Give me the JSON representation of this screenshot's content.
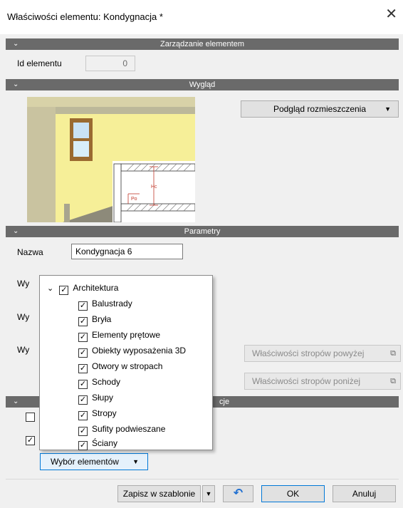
{
  "window": {
    "title": "Właściwości elementu: Kondygnacja *",
    "close_glyph": "✕"
  },
  "sections": {
    "management": "Zarządzanie elementem",
    "appearance": "Wygląd",
    "parameters": "Parametry",
    "fourth": "cje"
  },
  "management": {
    "id_label": "Id elementu",
    "id_value": "0"
  },
  "appearance": {
    "preview_dropdown": "Podgląd rozmieszczenia",
    "hc_label": "Hc",
    "po_label": "Po"
  },
  "parameters": {
    "name_label": "Nazwa",
    "name_value": "Kondygnacja 6",
    "partial_label_1": "Wy",
    "partial_label_2": "Wy",
    "partial_label_3": "Wy",
    "floors_above_button": "Właściwości stropów powyżej",
    "floors_below_button": "Właściwości stropów poniżej"
  },
  "popup": {
    "root": "Architektura",
    "items": [
      "Balustrady",
      "Bryła",
      "Elementy prętowe",
      "Obiekty wyposażenia 3D",
      "Otwory w stropach",
      "Schody",
      "Słupy",
      "Stropy",
      "Sufity podwieszane",
      "Ściany"
    ],
    "check_glyph": "✓",
    "expand_glyph": "⌄"
  },
  "elements_select_button": "Wybór elementów",
  "footer": {
    "save_template": "Zapisz w szablonie",
    "ok": "OK",
    "cancel": "Anuluj",
    "undo_glyph": "↶"
  },
  "icons": {
    "chevron": "⌄",
    "dropdown_arrow": "▼",
    "external": "⧉"
  }
}
